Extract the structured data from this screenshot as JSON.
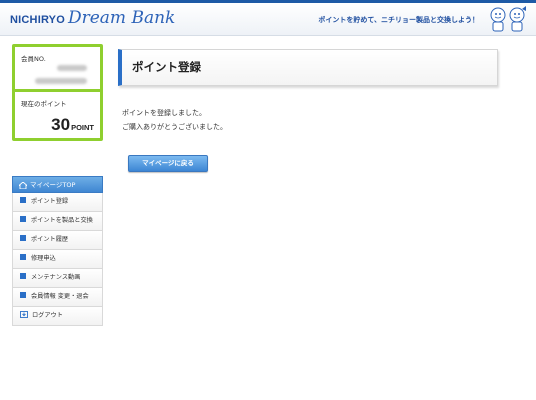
{
  "header": {
    "brand": "NICHIRYO",
    "brand_script": "Dream Bank",
    "slogan": "ポイントを貯めて、ニチリョー製品と交換しよう！",
    "mascot_icon": "mascot-characters"
  },
  "member": {
    "no_label": "会員NO.",
    "points_label": "現在のポイント",
    "points_value": "30",
    "points_unit": "POINT"
  },
  "nav": {
    "top_label": "マイページTOP",
    "items": [
      {
        "label": "ポイント登録"
      },
      {
        "label": "ポイントを製品と交換"
      },
      {
        "label": "ポイント履歴"
      },
      {
        "label": "修理申込"
      },
      {
        "label": "メンテナンス動画"
      },
      {
        "label": "会員情報 変更・退会"
      },
      {
        "label": "ログアウト"
      }
    ]
  },
  "main": {
    "title": "ポイント登録",
    "message_line1": "ポイントを登録しました。",
    "message_line2": "ご購入ありがとうございました。",
    "back_button": "マイページに戻る"
  },
  "colors": {
    "accent": "#2a6fc7",
    "member_border": "#8fcf2f",
    "brand": "#1f4fa0"
  }
}
